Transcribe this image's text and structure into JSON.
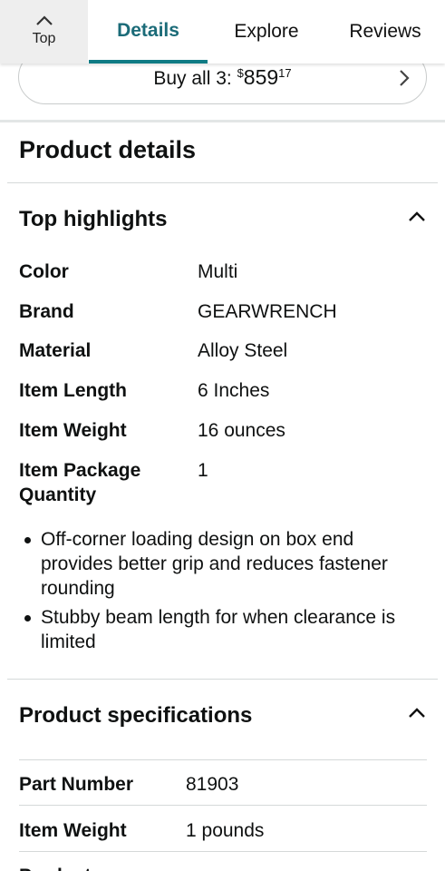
{
  "nav": {
    "top_label": "Top",
    "tabs": [
      {
        "label": "Details",
        "active": true
      },
      {
        "label": "Explore",
        "active": false
      },
      {
        "label": "Reviews",
        "active": false
      }
    ],
    "accent_color": "#0f7b84"
  },
  "buy_all": {
    "prefix": "Buy all 3: ",
    "currency": "$",
    "whole": "859",
    "fraction": "17"
  },
  "product_details": {
    "title": "Product details",
    "top_highlights": {
      "title": "Top highlights",
      "rows": [
        {
          "key": "Color",
          "value": "Multi"
        },
        {
          "key": "Brand",
          "value": "GEARWRENCH"
        },
        {
          "key": "Material",
          "value": "Alloy Steel"
        },
        {
          "key": "Item Length",
          "value": "6 Inches"
        },
        {
          "key": "Item Weight",
          "value": "16 ounces"
        },
        {
          "key": "Item Package",
          "key2": "Quantity",
          "value": "1"
        }
      ],
      "bullets": [
        "Off-corner loading design on box end provides better grip and reduces fastener rounding",
        "Stubby beam length for when clearance is limited"
      ]
    },
    "specifications": {
      "title": "Product specifications",
      "rows": [
        {
          "key": "Part Number",
          "value": "81903"
        },
        {
          "key": "Item Weight",
          "value": "1 pounds"
        },
        {
          "key": "Product",
          "value": ""
        }
      ]
    }
  }
}
